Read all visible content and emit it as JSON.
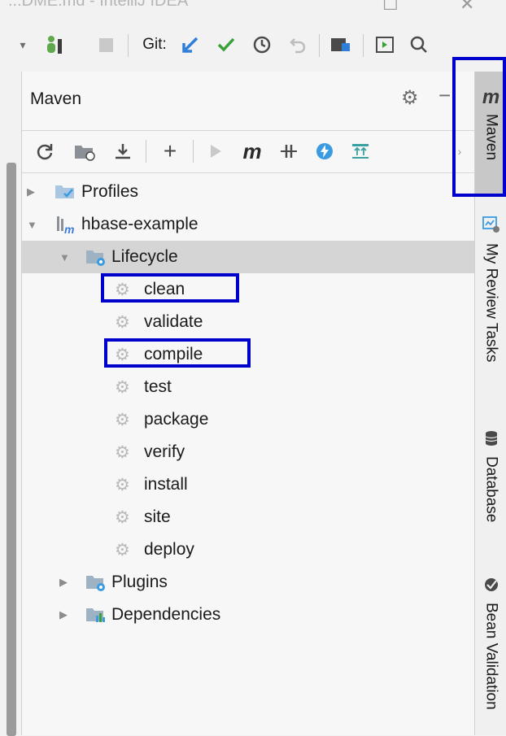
{
  "window": {
    "title": "...DME.md - IntelliJ IDEA"
  },
  "toolbar": {
    "git_label": "Git:"
  },
  "maven": {
    "title": "Maven",
    "tree": [
      {
        "label": "Profiles",
        "level": 0,
        "expanded": false,
        "icon": "profiles-folder-icon"
      },
      {
        "label": "hbase-example",
        "level": 0,
        "expanded": true,
        "icon": "maven-module-icon"
      },
      {
        "label": "Lifecycle",
        "level": 1,
        "expanded": true,
        "icon": "lifecycle-folder-icon",
        "selected": true
      },
      {
        "label": "clean",
        "level": 2,
        "icon": "gear-icon"
      },
      {
        "label": "validate",
        "level": 2,
        "icon": "gear-icon"
      },
      {
        "label": "compile",
        "level": 2,
        "icon": "gear-icon"
      },
      {
        "label": "test",
        "level": 2,
        "icon": "gear-icon"
      },
      {
        "label": "package",
        "level": 2,
        "icon": "gear-icon"
      },
      {
        "label": "verify",
        "level": 2,
        "icon": "gear-icon"
      },
      {
        "label": "install",
        "level": 2,
        "icon": "gear-icon"
      },
      {
        "label": "site",
        "level": 2,
        "icon": "gear-icon"
      },
      {
        "label": "deploy",
        "level": 2,
        "icon": "gear-icon"
      },
      {
        "label": "Plugins",
        "level": 1,
        "expanded": false,
        "icon": "plugins-folder-icon"
      },
      {
        "label": "Dependencies",
        "level": 1,
        "expanded": false,
        "icon": "dependencies-folder-icon"
      }
    ]
  },
  "right_strip": {
    "tabs": [
      {
        "label": "Maven",
        "icon": "maven-m-icon",
        "active": true
      },
      {
        "label": "My Review Tasks",
        "icon": "review-tasks-icon"
      },
      {
        "label": "Database",
        "icon": "database-icon"
      },
      {
        "label": "Bean Validation",
        "icon": "bean-validation-icon"
      }
    ]
  },
  "colors": {
    "highlight": "#0000cc",
    "selection": "#d5d5d5",
    "git_update_blue": "#2f7fd8",
    "git_commit_green": "#3aa03a",
    "folder_blue": "#6aa6d6"
  }
}
